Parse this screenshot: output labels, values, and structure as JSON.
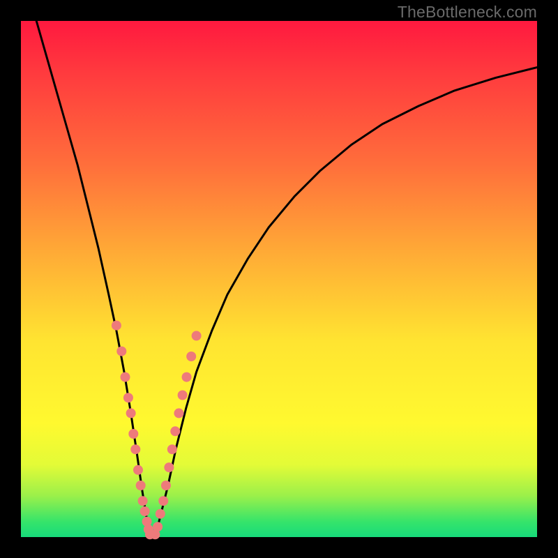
{
  "watermark": "TheBottleneck.com",
  "colors": {
    "dot": "#ee7a7b",
    "curve": "#000000",
    "frame": "#000000"
  },
  "chart_data": {
    "type": "line",
    "title": "",
    "xlabel": "",
    "ylabel": "",
    "xlim": [
      0,
      100
    ],
    "ylim": [
      0,
      100
    ],
    "grid": false,
    "legend": false,
    "series": [
      {
        "name": "bottleneck-curve",
        "x": [
          3,
          5,
          7,
          9,
          11,
          13,
          15,
          17,
          18.5,
          20,
          21.3,
          22.5,
          23.5,
          24.3,
          25,
          26,
          27,
          28.5,
          30,
          32,
          34,
          37,
          40,
          44,
          48,
          53,
          58,
          64,
          70,
          77,
          84,
          92,
          100
        ],
        "y": [
          100,
          93,
          86,
          79,
          72,
          64,
          56,
          47,
          40,
          32,
          24,
          16,
          9,
          4,
          0,
          0,
          4,
          10,
          17,
          25,
          32,
          40,
          47,
          54,
          60,
          66,
          71,
          76,
          80,
          83.5,
          86.5,
          89,
          91
        ]
      }
    ],
    "markers": [
      {
        "name": "left-branch-dots",
        "x": [
          18.5,
          19.5,
          20.2,
          20.8,
          21.3,
          21.8,
          22.2,
          22.7,
          23.2,
          23.6,
          24,
          24.4,
          24.7,
          25
        ],
        "y": [
          41,
          36,
          31,
          27,
          24,
          20,
          17,
          13,
          10,
          7,
          5,
          3,
          1.5,
          0.5
        ]
      },
      {
        "name": "right-branch-dots",
        "x": [
          26,
          26.5,
          27,
          27.6,
          28.1,
          28.7,
          29.3,
          29.9,
          30.6,
          31.3,
          32.1,
          33,
          34
        ],
        "y": [
          0.5,
          2,
          4.5,
          7,
          10,
          13.5,
          17,
          20.5,
          24,
          27.5,
          31,
          35,
          39
        ]
      }
    ]
  }
}
